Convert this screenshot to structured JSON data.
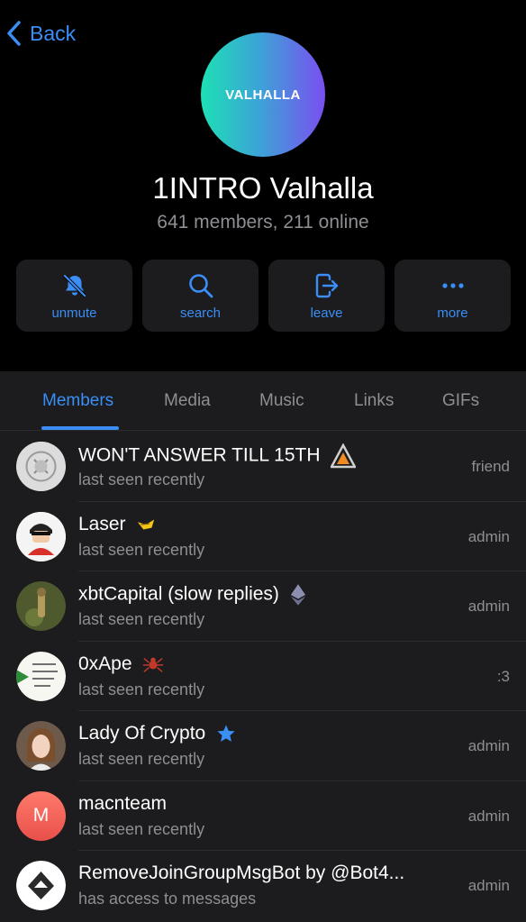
{
  "nav": {
    "back_label": "Back"
  },
  "group": {
    "avatar_text": "VALHALLA",
    "title": "1INTRO Valhalla",
    "subtitle": "641 members, 211 online"
  },
  "actions": [
    {
      "label": "unmute",
      "icon": "bell-slash-icon"
    },
    {
      "label": "search",
      "icon": "search-icon"
    },
    {
      "label": "leave",
      "icon": "leave-icon"
    },
    {
      "label": "more",
      "icon": "more-icon"
    }
  ],
  "tabs": [
    "Members",
    "Media",
    "Music",
    "Links",
    "GIFs"
  ],
  "active_tab": "Members",
  "members": [
    {
      "name": "WON'T ANSWER TILL 15TH",
      "status": "last seen recently",
      "role": "friend",
      "badge": "triangle-logo-icon"
    },
    {
      "name": "Laser",
      "status": "last seen recently",
      "role": "admin",
      "badge": "laser-emoji-icon"
    },
    {
      "name": "xbtCapital (slow replies)",
      "status": "last seen recently",
      "role": "admin",
      "badge": "ethereum-icon"
    },
    {
      "name": "0xApe",
      "status": "last seen recently",
      "role": ":3",
      "badge": "spider-icon"
    },
    {
      "name": "Lady Of Crypto",
      "status": "last seen recently",
      "role": "admin",
      "badge": "verified-star-icon"
    },
    {
      "name": "macnteam",
      "status": "last seen recently",
      "role": "admin",
      "avatar_letter": "M"
    },
    {
      "name": "RemoveJoinGroupMsgBot by @Bot4...",
      "status": "has access to messages",
      "role": "admin"
    }
  ],
  "colors": {
    "accent": "#3a8ef6",
    "panel": "#1c1c1e",
    "muted": "#8e8e93"
  }
}
